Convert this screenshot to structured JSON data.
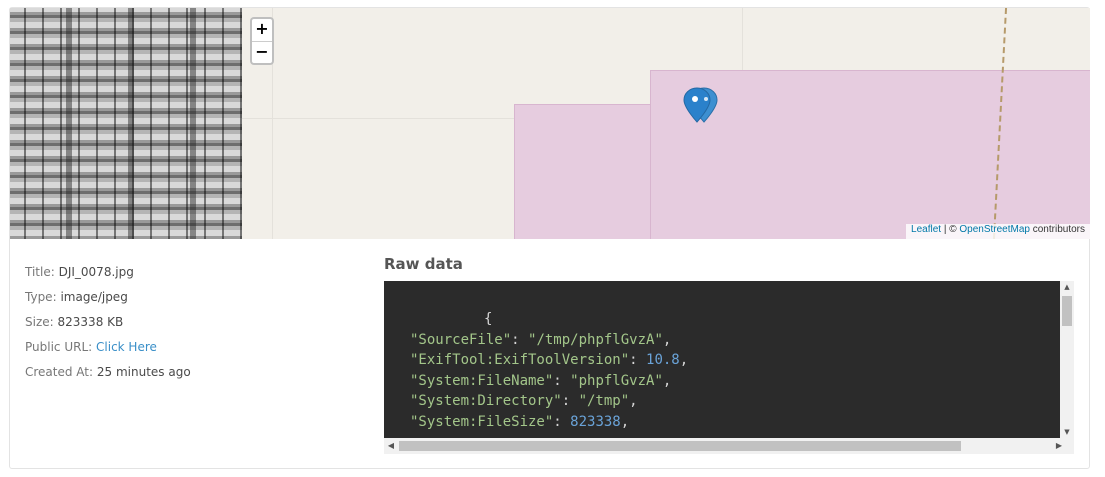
{
  "map": {
    "zoom_in": "+",
    "zoom_out": "−",
    "marker_icon": "map-marker-icon",
    "attribution": {
      "leaflet": "Leaflet",
      "separator": " | © ",
      "osm": "OpenStreetMap",
      "suffix": " contributors"
    }
  },
  "meta": {
    "title_label": "Title:",
    "title_value": "DJI_0078.jpg",
    "type_label": "Type:",
    "type_value": "image/jpeg",
    "size_label": "Size:",
    "size_value": "823338 KB",
    "url_label": "Public URL:",
    "url_link": "Click Here",
    "created_label": "Created At:",
    "created_value": "25 minutes ago"
  },
  "raw": {
    "heading": "Raw data",
    "open_brace": "{",
    "lines": [
      {
        "key": "\"SourceFile\"",
        "sep": ": ",
        "value": "\"/tmp/phpflGvzA\"",
        "vtype": "str"
      },
      {
        "key": "\"ExifTool:ExifToolVersion\"",
        "sep": ": ",
        "value": "10.8",
        "vtype": "num"
      },
      {
        "key": "\"System:FileName\"",
        "sep": ": ",
        "value": "\"phpflGvzA\"",
        "vtype": "str"
      },
      {
        "key": "\"System:Directory\"",
        "sep": ": ",
        "value": "\"/tmp\"",
        "vtype": "str"
      },
      {
        "key": "\"System:FileSize\"",
        "sep": ": ",
        "value": "823338",
        "vtype": "num"
      }
    ]
  },
  "colors": {
    "accent_link": "#3a8fc8",
    "code_bg": "#2b2b2b",
    "zone": "#e6ccdf",
    "marker": "#2a81cb"
  }
}
